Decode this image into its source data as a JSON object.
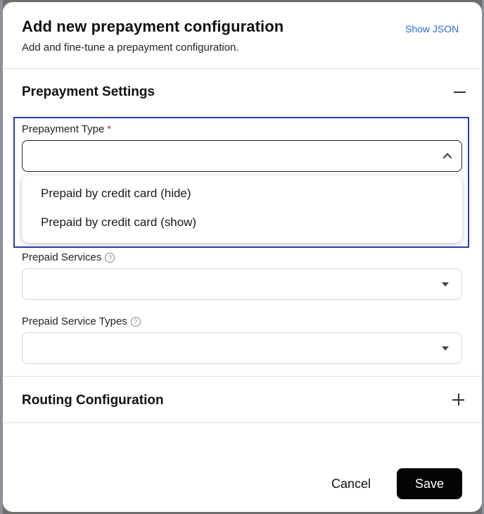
{
  "modal": {
    "title": "Add new prepayment configuration",
    "subtitle": "Add and fine-tune a prepayment configuration.",
    "show_json_label": "Show JSON"
  },
  "prepayment_settings": {
    "title": "Prepayment Settings",
    "prepayment_type": {
      "label": "Prepayment Type",
      "required_marker": "*",
      "value": "",
      "options": [
        "Prepaid by credit card (hide)",
        "Prepaid by credit card (show)"
      ]
    },
    "prepaid_services": {
      "label": "Prepaid Services",
      "help": "?",
      "value": ""
    },
    "prepaid_service_types": {
      "label": "Prepaid Service Types",
      "help": "?",
      "value": ""
    }
  },
  "routing_configuration": {
    "title": "Routing Configuration"
  },
  "footer": {
    "cancel_label": "Cancel",
    "save_label": "Save"
  },
  "icons": {
    "collapse": "minus-icon",
    "expand": "plus-icon",
    "chevron": "chevron-up-icon",
    "caret": "caret-down-icon",
    "help": "help-circle-icon"
  },
  "colors": {
    "accent_link": "#2d6bd8",
    "focus_outline": "#2a3db0",
    "required": "#c0392b",
    "primary_button": "#050505"
  }
}
